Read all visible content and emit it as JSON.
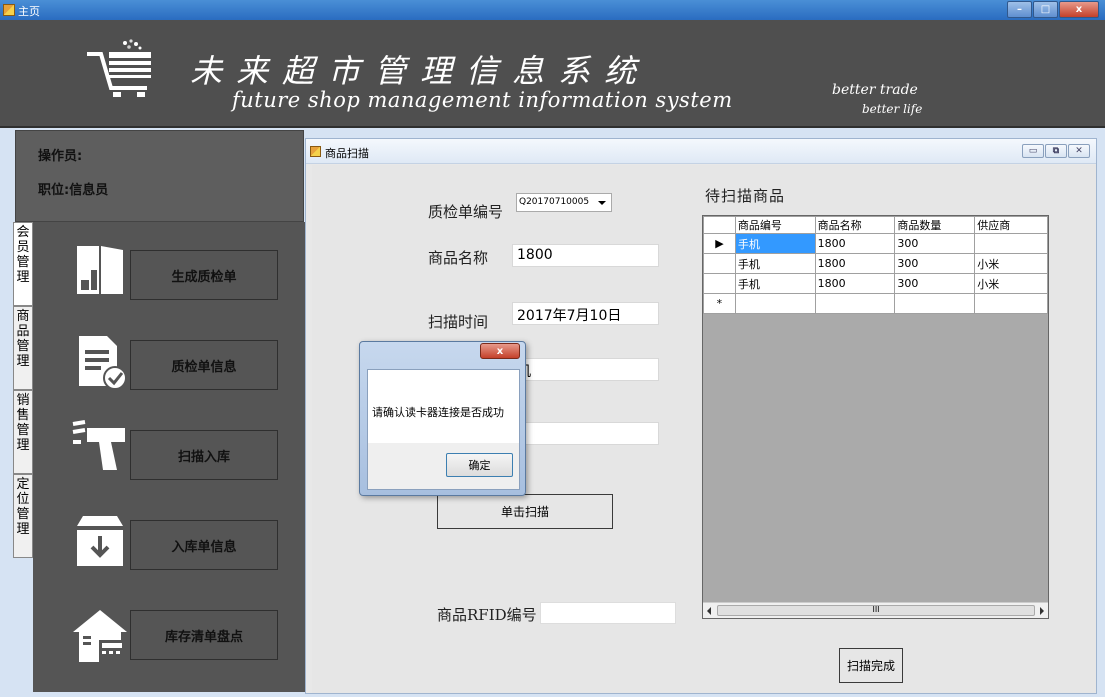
{
  "window": {
    "title": "主页",
    "min": "–",
    "max": "□",
    "close": "x"
  },
  "banner": {
    "title_cn": "未来超市管理信息系统",
    "title_en": "future shop management information system",
    "slogan_line1": "better trade",
    "slogan_line2": "better life"
  },
  "left": {
    "operator_label": "操作员:",
    "position_label": "职位:信息员",
    "vtabs": [
      "会员管理",
      "商品管理",
      "销售管理",
      "定位管理"
    ],
    "menu": [
      {
        "label": "生成质检单",
        "icon": "document-icon"
      },
      {
        "label": "质检单信息",
        "icon": "document-check-icon"
      },
      {
        "label": "扫描入库",
        "icon": "scanner-gun-icon"
      },
      {
        "label": "入库单信息",
        "icon": "archive-box-icon"
      },
      {
        "label": "库存清单盘点",
        "icon": "warehouse-calculator-icon"
      }
    ]
  },
  "child": {
    "title": "商品扫描",
    "form": {
      "qc_label": "质检单编号",
      "qc_value": "Q20170710005",
      "name_label": "商品名称",
      "name_value": "1800",
      "time_label": "扫描时间",
      "time_value": "2017年7月10日",
      "field4_value": "机",
      "field5_value": "1",
      "scan_button": "单击扫描",
      "rfid_label": "商品RFID编号",
      "rfid_value": "",
      "done_button": "扫描完成"
    },
    "grid": {
      "title": "待扫描商品",
      "columns": [
        "商品编号",
        "商品名称",
        "商品数量",
        "供应商"
      ],
      "rows": [
        [
          "手机",
          "1800",
          "300",
          ""
        ],
        [
          "手机",
          "1800",
          "300",
          "小米"
        ],
        [
          "手机",
          "1800",
          "300",
          "小米"
        ]
      ],
      "current_row_marker": "▶",
      "new_row_marker": "*",
      "scroll_grip": "III"
    }
  },
  "dialog": {
    "message": "请确认读卡器连接是否成功",
    "ok_button": "确定",
    "close": "x"
  },
  "colors": {
    "banner_bg": "#4f4f4f",
    "menu_bg": "#555555",
    "selection": "#3399ff",
    "titlebar": "#2a6cc0"
  }
}
